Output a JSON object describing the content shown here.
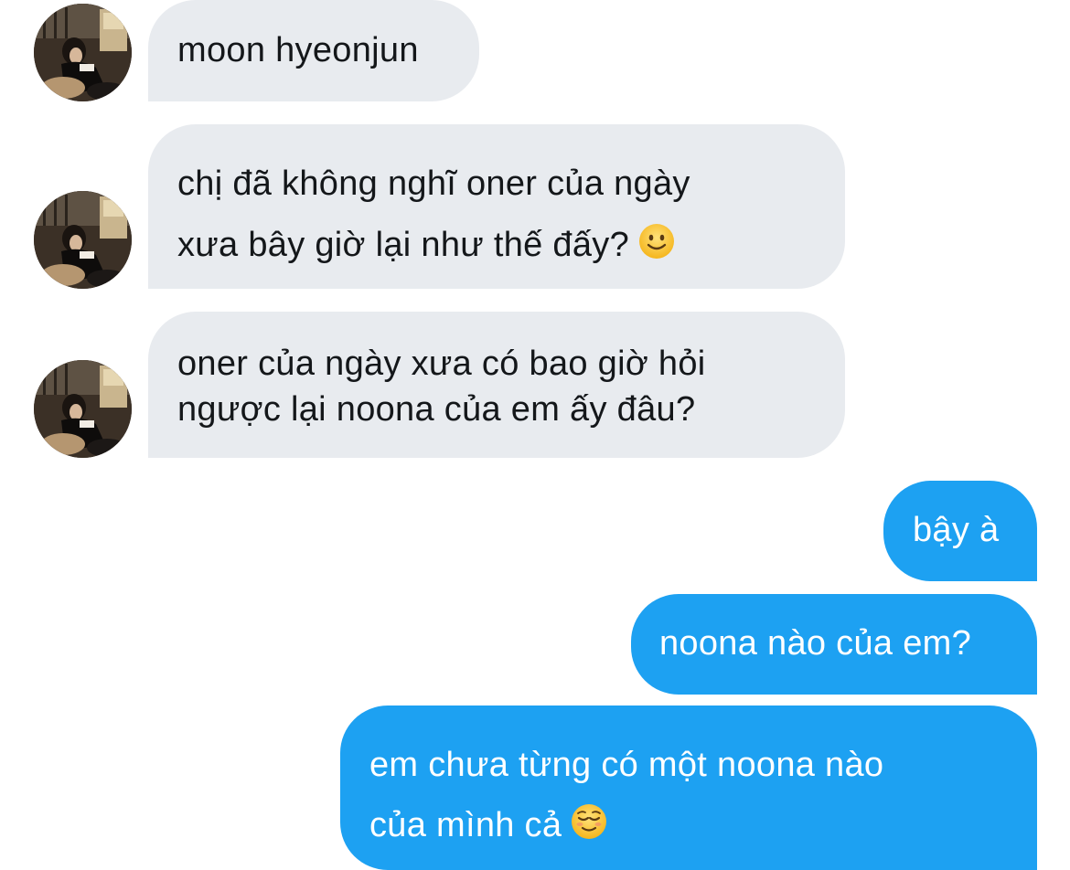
{
  "conversation": {
    "incoming": [
      {
        "lines": [
          "moon hyeonjun"
        ]
      },
      {
        "lines": [
          "chị đã không nghĩ oner của ngày",
          "xưa bây giờ lại như thế đấy?"
        ],
        "emoji": "slightly-smiling-face"
      },
      {
        "lines": [
          "oner của ngày xưa có bao giờ hỏi",
          "ngược lại noona của em ấy đâu?"
        ]
      }
    ],
    "outgoing": [
      {
        "lines": [
          "bậy à"
        ]
      },
      {
        "lines": [
          "noona nào của em?"
        ]
      },
      {
        "lines": [
          "em chưa từng có một noona nào",
          "của mình cả"
        ],
        "emoji": "relieved-face"
      }
    ]
  },
  "colors": {
    "incoming_bubble": "#e8ebef",
    "outgoing_bubble": "#1da1f2",
    "incoming_text": "#14171a",
    "outgoing_text": "#ffffff"
  }
}
